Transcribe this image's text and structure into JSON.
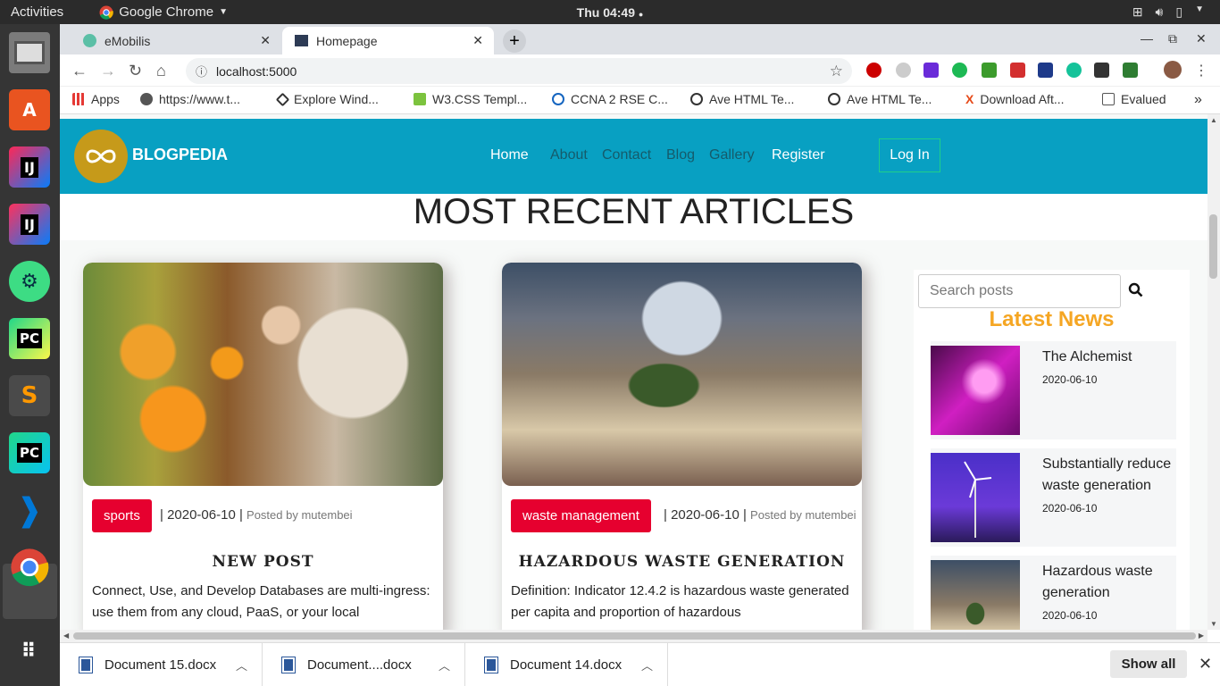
{
  "system": {
    "activities": "Activities",
    "app_name": "Google Chrome",
    "clock": "Thu 04:49"
  },
  "browser": {
    "tabs": [
      {
        "label": "eMobilis"
      },
      {
        "label": "Homepage"
      }
    ],
    "url": "localhost:5000",
    "bookmarks": [
      {
        "label": "Apps"
      },
      {
        "label": "https://www.t..."
      },
      {
        "label": "Explore Wind..."
      },
      {
        "label": "W3.CSS Templ..."
      },
      {
        "label": "CCNA 2 RSE C..."
      },
      {
        "label": "Ave HTML Te..."
      },
      {
        "label": "Ave HTML Te..."
      },
      {
        "label": "Download Aft..."
      },
      {
        "label": "Evalued"
      }
    ]
  },
  "site": {
    "brand": "BLOGPEDIA",
    "nav": [
      "Home",
      "About",
      "Contact",
      "Blog",
      "Gallery",
      "Register"
    ],
    "login": "Log In",
    "heading": "MOST RECENT ARTICLES",
    "articles": [
      {
        "tag": "sports",
        "date": "| 2020-06-10 |",
        "posted_by": "Posted by mutembei",
        "title": "NEW POST",
        "excerpt": "Connect, Use, and Develop Databases are multi-ingress: use them from any cloud, PaaS, or your local"
      },
      {
        "tag": "waste management",
        "date": "| 2020-06-10 |",
        "posted_by": "Posted by mutembei",
        "title": "HAZARDOUS WASTE GENERATION",
        "excerpt": "Definition: Indicator 12.4.2 is hazardous waste generated per capita and proportion of hazardous"
      }
    ],
    "sidebar": {
      "search_placeholder": "Search posts",
      "latest_title": "Latest News",
      "news": [
        {
          "title": "The Alchemist",
          "date": "2020-06-10"
        },
        {
          "title": "Substantially reduce waste generation",
          "date": "2020-06-10"
        },
        {
          "title": "Hazardous waste generation",
          "date": "2020-06-10"
        }
      ]
    }
  },
  "downloads": {
    "items": [
      {
        "name": "Document 15.docx"
      },
      {
        "name": "Document....docx"
      },
      {
        "name": "Document 14.docx"
      }
    ],
    "show_all": "Show all"
  }
}
